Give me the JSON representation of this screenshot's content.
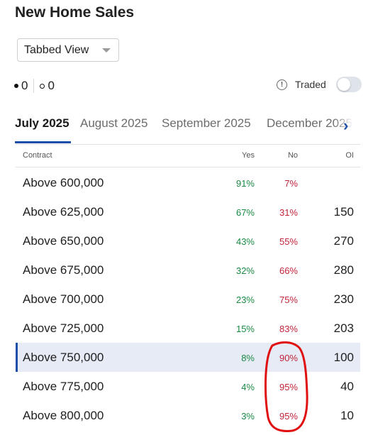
{
  "page": {
    "title": "New Home Sales"
  },
  "view_select": {
    "value": "Tabbed View"
  },
  "counts": {
    "filled": "0",
    "open": "0"
  },
  "traded": {
    "label": "Traded",
    "enabled": false
  },
  "tabs": [
    {
      "label": "July 2025",
      "active": true
    },
    {
      "label": "August 2025",
      "active": false
    },
    {
      "label": "September 2025",
      "active": false
    },
    {
      "label": "December 2025",
      "active": false
    }
  ],
  "table": {
    "headers": {
      "contract": "Contract",
      "yes": "Yes",
      "no": "No",
      "oi": "OI"
    },
    "rows": [
      {
        "contract": "Above 600,000",
        "yes": "91%",
        "no": "7%",
        "oi": ""
      },
      {
        "contract": "Above 625,000",
        "yes": "67%",
        "no": "31%",
        "oi": "150"
      },
      {
        "contract": "Above 650,000",
        "yes": "43%",
        "no": "55%",
        "oi": "270"
      },
      {
        "contract": "Above 675,000",
        "yes": "32%",
        "no": "66%",
        "oi": "280"
      },
      {
        "contract": "Above 700,000",
        "yes": "23%",
        "no": "75%",
        "oi": "230"
      },
      {
        "contract": "Above 725,000",
        "yes": "15%",
        "no": "83%",
        "oi": "203"
      },
      {
        "contract": "Above 750,000",
        "yes": "8%",
        "no": "90%",
        "oi": "100",
        "selected": true
      },
      {
        "contract": "Above 775,000",
        "yes": "4%",
        "no": "95%",
        "oi": "40"
      },
      {
        "contract": "Above 800,000",
        "yes": "3%",
        "no": "95%",
        "oi": "10"
      }
    ]
  },
  "colors": {
    "accent": "#1d4fa8",
    "yes": "#1a8a44",
    "no": "#c0233a",
    "annotation": "#e01010",
    "selected_row": "#e6ebf5"
  }
}
